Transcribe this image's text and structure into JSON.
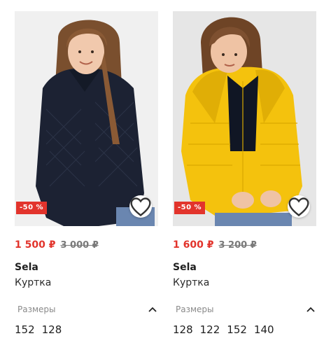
{
  "products": [
    {
      "badge": "-50 %",
      "price_now": "1 500 ₽",
      "price_old": "3 000 ₽",
      "brand": "Sela",
      "kind": "Куртка",
      "sizes_label": "Размеры",
      "sizes": [
        "152",
        "128"
      ],
      "jacket_color": "#1c2233"
    },
    {
      "badge": "-50 %",
      "price_now": "1 600 ₽",
      "price_old": "3 200 ₽",
      "brand": "Sela",
      "kind": "Куртка",
      "sizes_label": "Размеры",
      "sizes": [
        "128",
        "122",
        "152",
        "140"
      ],
      "jacket_color": "#f4c20d"
    }
  ],
  "colors": {
    "sale": "#e2342c",
    "text": "#1f1f1f",
    "muted": "#8a8a8a"
  },
  "icons": {
    "favorite": "heart-icon",
    "collapse": "chevron-up-icon"
  }
}
